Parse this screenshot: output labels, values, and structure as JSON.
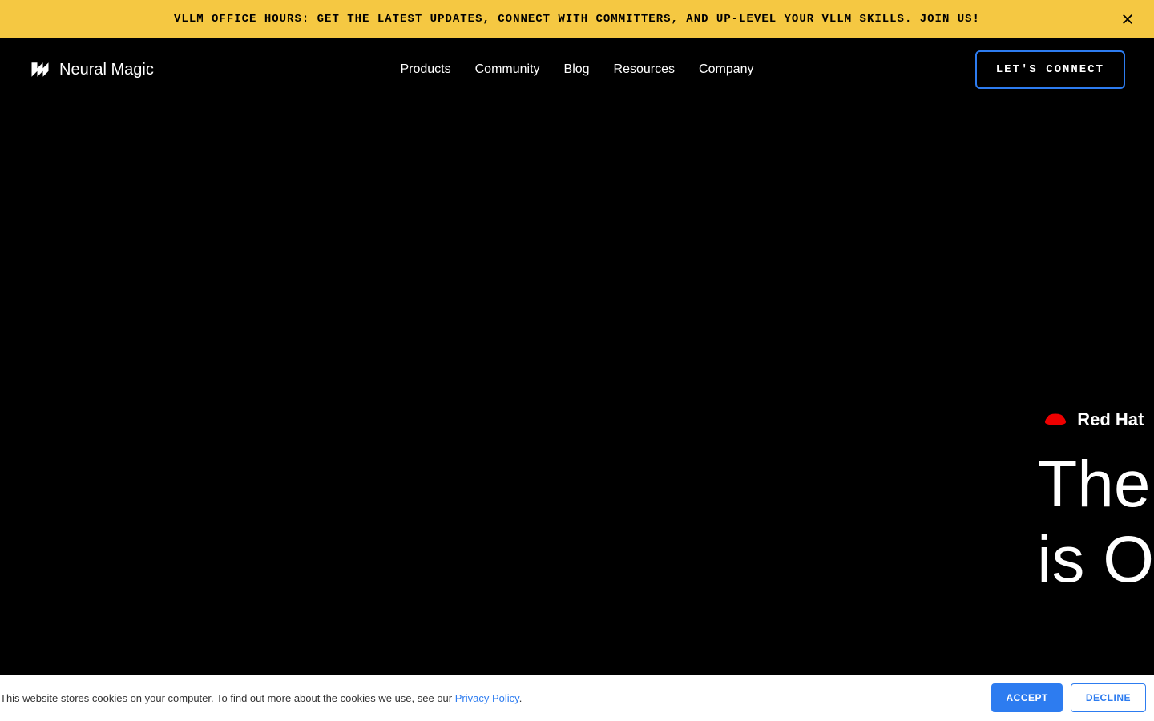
{
  "announcement": {
    "text": "VLLM OFFICE HOURS: GET THE LATEST UPDATES, CONNECT WITH COMMITTERS, AND UP-LEVEL YOUR VLLM SKILLS. JOIN US!"
  },
  "logo": {
    "text": "Neural Magic"
  },
  "nav": {
    "products": "Products",
    "community": "Community",
    "blog": "Blog",
    "resources": "Resources",
    "company": "Company"
  },
  "cta": {
    "label": "LET'S CONNECT"
  },
  "hero": {
    "redhat_label": "Red Hat",
    "title_line1": "The",
    "title_line2": "is O"
  },
  "cookie": {
    "text_before": "This website stores cookies on your computer. To find out more about the cookies we use, see our ",
    "link": "Privacy Policy",
    "text_after": ".",
    "accept": "ACCEPT",
    "decline": "DECLINE"
  }
}
